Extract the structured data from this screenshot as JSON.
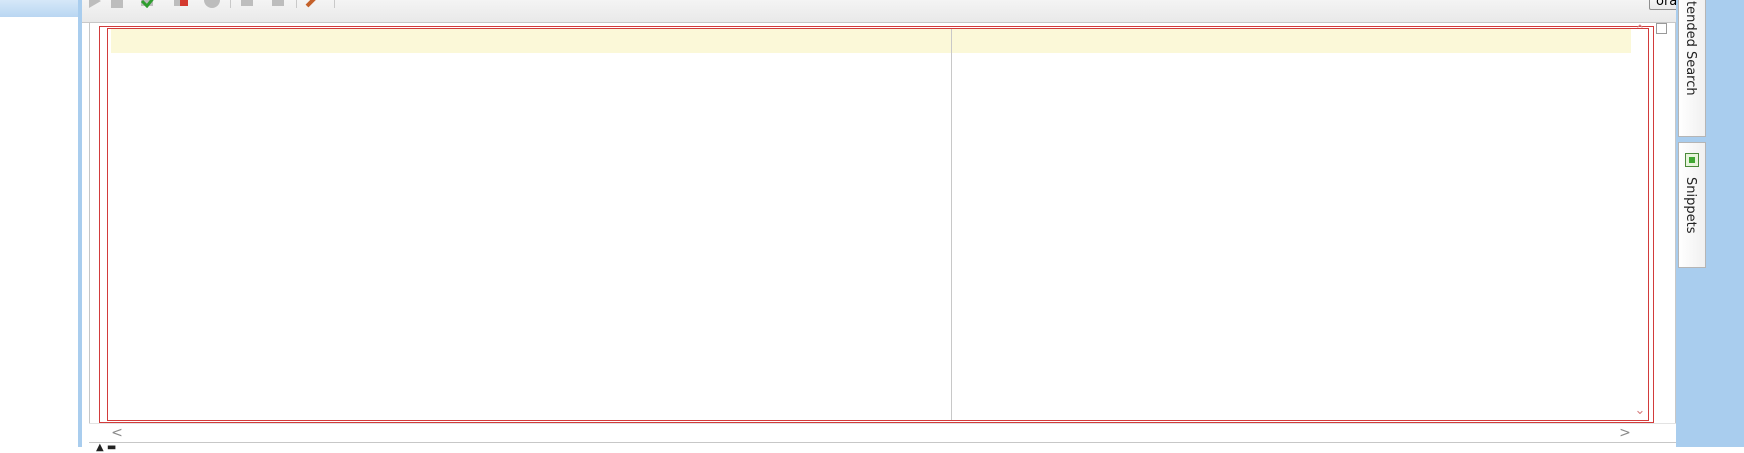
{
  "toolbar": {
    "connection_value": "ora_hr",
    "icons": [
      "run-statement-icon",
      "run-script-icon",
      "commit-icon",
      "rollback-icon",
      "cancel-icon",
      "sql-history-icon",
      "explain-plan-icon",
      "clear-icon"
    ]
  },
  "side_panel": {
    "extended_search_label": "tended Search",
    "snippets_label": "Snippets"
  },
  "scrollbars": {
    "up_glyph": "⌃",
    "down_glyph": "⌄",
    "left_glyph": "<",
    "right_glyph": ">"
  },
  "status": {
    "marker": "▲ ▬"
  },
  "colors": {
    "frame_blue": "#a9cdee",
    "highlight_line": "#fbf8d8",
    "selection_red": "#d23b3b"
  }
}
